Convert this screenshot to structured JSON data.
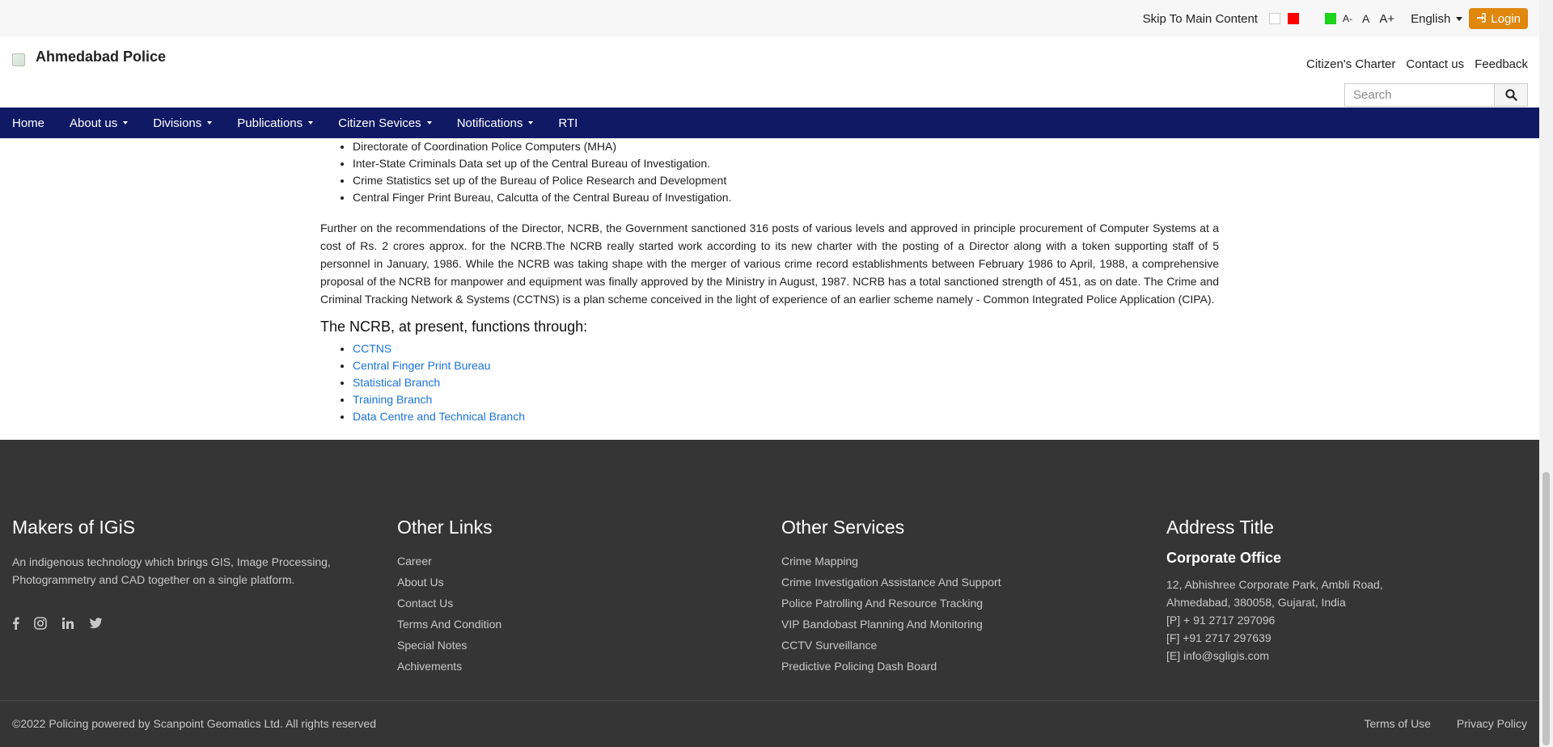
{
  "utility_bar": {
    "skip_text": "Skip To Main Content",
    "font_small": "A-",
    "font_normal": "A",
    "font_large": "A+",
    "language": "English",
    "login_label": "Login",
    "theme_colors": [
      "#ffffff",
      "#ff0000",
      "#1bd41b"
    ]
  },
  "header": {
    "site_title": "Ahmedabad Police",
    "links": [
      "Citizen's Charter",
      "Contact us",
      "Feedback"
    ],
    "search_placeholder": "Search"
  },
  "nav": {
    "items": [
      {
        "label": "Home",
        "dropdown": false
      },
      {
        "label": "About us",
        "dropdown": true
      },
      {
        "label": "Divisions",
        "dropdown": true
      },
      {
        "label": "Publications",
        "dropdown": true
      },
      {
        "label": "Citizen Sevices",
        "dropdown": true
      },
      {
        "label": "Notifications",
        "dropdown": true
      },
      {
        "label": "RTI",
        "dropdown": false
      }
    ],
    "bg_color": "#0f1964"
  },
  "content": {
    "top_list": [
      "Directorate of Coordination Police Computers (MHA)",
      "Inter-State Criminals Data set up of the Central Bureau of Investigation.",
      "Crime Statistics set up of the Bureau of Police Research and Development",
      "Central Finger Print Bureau, Calcutta of the Central Bureau of Investigation."
    ],
    "paragraph": "Further on the recommendations of the Director, NCRB, the Government sanctioned 316 posts of various levels and approved in principle procurement of Computer Systems at a cost of Rs. 2 crores approx. for the NCRB.The NCRB really started work according to its new charter with the posting of a Director along with a token supporting staff of 5 personnel in January, 1986. While the NCRB was taking shape with the merger of various crime record establishments between February 1986 to April, 1988, a comprehensive proposal of the NCRB for manpower and equipment was finally approved by the Ministry in August, 1987. NCRB has a total sanctioned strength of 451, as on date. The Crime and Criminal Tracking Network & Systems (CCTNS) is a plan scheme conceived in the light of experience of an earlier scheme namely - Common Integrated Police Application (CIPA).",
    "functions_heading": "The NCRB, at present, functions through:",
    "function_links": [
      "CCTNS",
      "Central Finger Print Bureau",
      "Statistical Branch",
      "Training Branch",
      "Data Centre and Technical Branch"
    ]
  },
  "footer": {
    "makers": {
      "heading": "Makers of IGiS",
      "description_line1": "An indigenous technology which brings GIS, Image Processing,",
      "description_line2": "Photogrammetry and CAD together on a single platform."
    },
    "other_links": {
      "heading": "Other Links",
      "items": [
        "Career",
        "About Us",
        "Contact Us",
        "Terms And Condition",
        "Special Notes",
        "Achivements"
      ]
    },
    "other_services": {
      "heading": "Other Services",
      "items": [
        "Crime Mapping",
        "Crime Investigation Assistance And Support",
        "Police Patrolling And Resource Tracking",
        "VIP Bandobast Planning And Monitoring",
        "CCTV Surveillance",
        "Predictive Policing Dash Board"
      ]
    },
    "address": {
      "heading": "Address Title",
      "office": "Corporate Office",
      "lines": [
        "12, Abhishree Corporate Park, Ambli Road,",
        "Ahmedabad, 380058, Gujarat, India",
        "[P] + 91 2717 297096",
        "[F] +91 2717 297639",
        "[E] info@sgligis.com"
      ]
    },
    "copyright": "©2022 Policing powered by Scanpoint Geomatics Ltd. All rights reserved",
    "bottom_links": [
      "Terms of Use",
      "Privacy Policy"
    ],
    "bg_color": "#353535"
  }
}
